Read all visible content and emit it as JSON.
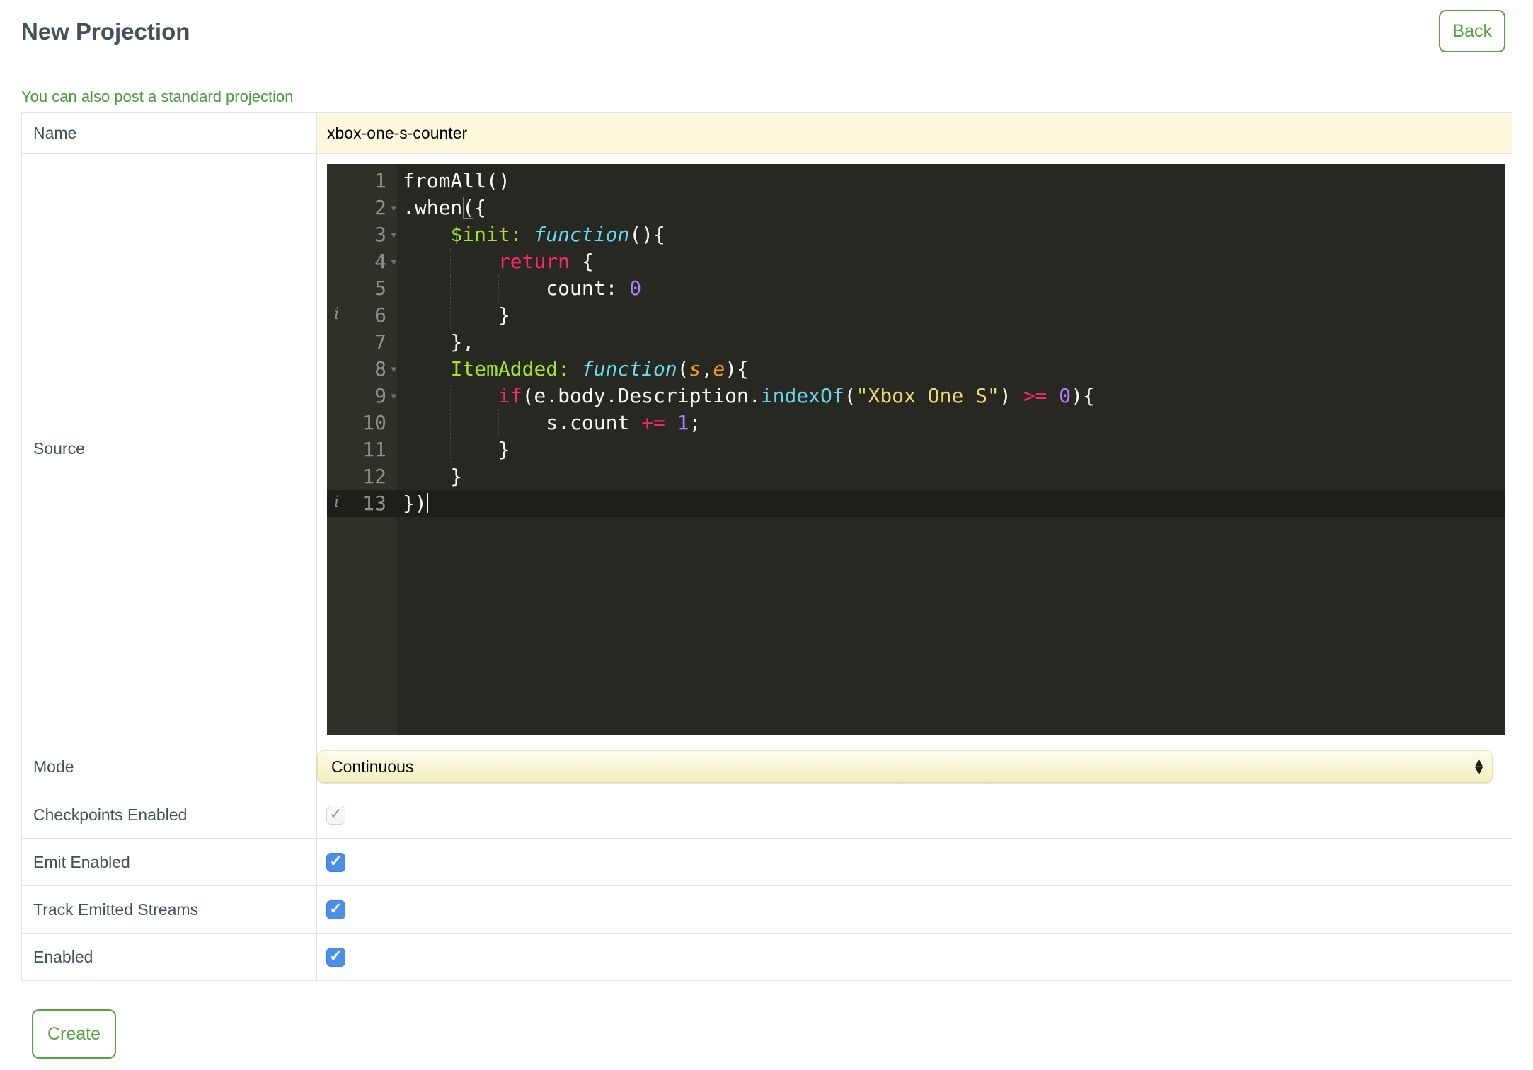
{
  "header": {
    "title": "New Projection",
    "back_label": "Back",
    "link_label": "You can also post a standard projection"
  },
  "form": {
    "rows": [
      {
        "label": "Name",
        "type": "input",
        "value": "xbox-one-s-counter"
      },
      {
        "label": "Source",
        "type": "editor"
      },
      {
        "label": "Mode",
        "type": "select",
        "value": "Continuous"
      },
      {
        "label": "Checkpoints Enabled",
        "type": "checkbox",
        "checked": true,
        "disabled": true
      },
      {
        "label": "Emit Enabled",
        "type": "checkbox",
        "checked": true,
        "disabled": false
      },
      {
        "label": "Track Emitted Streams",
        "type": "checkbox",
        "checked": true,
        "disabled": false
      },
      {
        "label": "Enabled",
        "type": "checkbox",
        "checked": true,
        "disabled": false
      }
    ]
  },
  "footer": {
    "create_label": "Create"
  },
  "icons": {
    "check": "✓",
    "fold": "▾",
    "info": "i",
    "select_up": "▲",
    "select_down": "▼"
  },
  "colors": {
    "accent_green": "#55a344",
    "label_slate": "#44505c",
    "input_yellow": "#fcf9dc",
    "checkbox_blue": "#4a8fe8",
    "editor_bg": "#272822",
    "editor_gutter": "#2f3129",
    "token_keyword": "#f92672",
    "token_entity": "#a6e22e",
    "token_function": "#66d9ef",
    "token_param": "#fd971f",
    "token_string": "#e6db74",
    "token_number": "#ae81ff"
  },
  "editor": {
    "language": "javascript",
    "active_line": 13,
    "cursor_line": 13,
    "lines": [
      {
        "n": 1,
        "fold": false,
        "info": false,
        "guides": [],
        "tokens": [
          {
            "c": "pl",
            "t": "fromAll()"
          }
        ]
      },
      {
        "n": 2,
        "fold": true,
        "info": false,
        "guides": [],
        "tokens": [
          {
            "c": "pl",
            "t": ".when"
          },
          {
            "c": "pl brk",
            "t": "("
          },
          {
            "c": "pl",
            "t": "{"
          }
        ]
      },
      {
        "n": 3,
        "fold": true,
        "info": false,
        "guides": [],
        "tokens": [
          {
            "c": "pl",
            "t": "    "
          },
          {
            "c": "en",
            "t": "$init:"
          },
          {
            "c": "pl",
            "t": " "
          },
          {
            "c": "fn",
            "t": "function"
          },
          {
            "c": "pl",
            "t": "(){"
          }
        ]
      },
      {
        "n": 4,
        "fold": true,
        "info": false,
        "guides": [
          4
        ],
        "tokens": [
          {
            "c": "pl",
            "t": "        "
          },
          {
            "c": "kw",
            "t": "return"
          },
          {
            "c": "pl",
            "t": " {"
          }
        ]
      },
      {
        "n": 5,
        "fold": false,
        "info": false,
        "guides": [
          4,
          8
        ],
        "tokens": [
          {
            "c": "pl",
            "t": "            count: "
          },
          {
            "c": "nu",
            "t": "0"
          }
        ]
      },
      {
        "n": 6,
        "fold": false,
        "info": true,
        "guides": [
          4
        ],
        "tokens": [
          {
            "c": "pl",
            "t": "        }"
          }
        ]
      },
      {
        "n": 7,
        "fold": false,
        "info": false,
        "guides": [],
        "tokens": [
          {
            "c": "pl",
            "t": "    },"
          }
        ]
      },
      {
        "n": 8,
        "fold": true,
        "info": false,
        "guides": [],
        "tokens": [
          {
            "c": "pl",
            "t": "    "
          },
          {
            "c": "en",
            "t": "ItemAdded:"
          },
          {
            "c": "pl",
            "t": " "
          },
          {
            "c": "fn",
            "t": "function"
          },
          {
            "c": "pl",
            "t": "("
          },
          {
            "c": "pr",
            "t": "s"
          },
          {
            "c": "pl",
            "t": ","
          },
          {
            "c": "pr",
            "t": "e"
          },
          {
            "c": "pl",
            "t": "){"
          }
        ]
      },
      {
        "n": 9,
        "fold": true,
        "info": false,
        "guides": [
          4
        ],
        "tokens": [
          {
            "c": "pl",
            "t": "        "
          },
          {
            "c": "kw",
            "t": "if"
          },
          {
            "c": "pl",
            "t": "(e.body.Description."
          },
          {
            "c": "sp",
            "t": "indexOf"
          },
          {
            "c": "pl",
            "t": "("
          },
          {
            "c": "st",
            "t": "\"Xbox One S\""
          },
          {
            "c": "pl",
            "t": ") "
          },
          {
            "c": "kw",
            "t": ">="
          },
          {
            "c": "pl",
            "t": " "
          },
          {
            "c": "nu",
            "t": "0"
          },
          {
            "c": "pl",
            "t": "){"
          }
        ]
      },
      {
        "n": 10,
        "fold": false,
        "info": false,
        "guides": [
          4,
          8
        ],
        "tokens": [
          {
            "c": "pl",
            "t": "            s.count "
          },
          {
            "c": "kw",
            "t": "+="
          },
          {
            "c": "pl",
            "t": " "
          },
          {
            "c": "nu",
            "t": "1"
          },
          {
            "c": "pl",
            "t": ";"
          }
        ]
      },
      {
        "n": 11,
        "fold": false,
        "info": false,
        "guides": [
          4
        ],
        "tokens": [
          {
            "c": "pl",
            "t": "        }"
          }
        ]
      },
      {
        "n": 12,
        "fold": false,
        "info": false,
        "guides": [],
        "tokens": [
          {
            "c": "pl",
            "t": "    }"
          }
        ]
      },
      {
        "n": 13,
        "fold": false,
        "info": true,
        "guides": [],
        "tokens": [
          {
            "c": "pl",
            "t": "})"
          }
        ]
      }
    ]
  }
}
